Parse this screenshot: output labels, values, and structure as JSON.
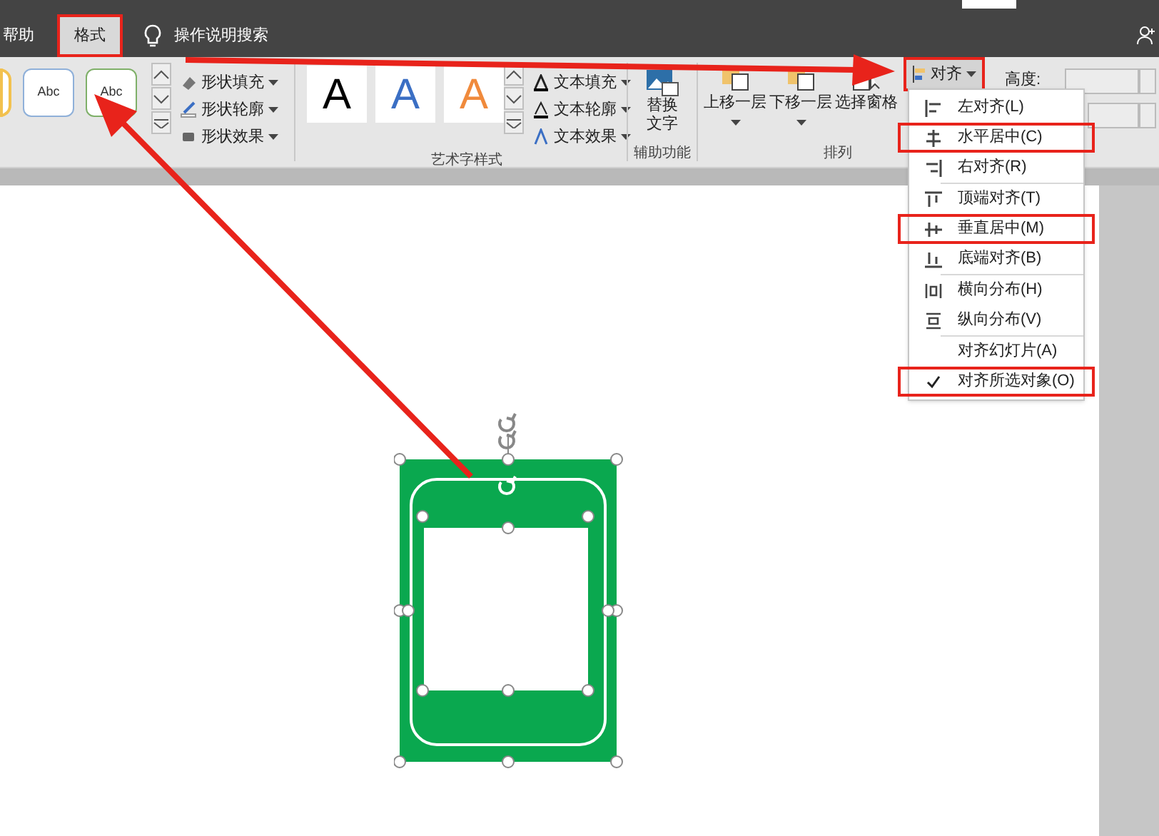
{
  "tabs": [
    {
      "label": "帮助",
      "selected": false,
      "highlighted": false
    },
    {
      "label": "格式",
      "selected": true,
      "highlighted": true
    }
  ],
  "search": {
    "placeholder": "操作说明搜索"
  },
  "shape_styles": [
    "Abc",
    "Abc"
  ],
  "shape_commands": [
    "形状填充",
    "形状轮廓",
    "形状效果"
  ],
  "wordart_styles": [
    {
      "letter": "A",
      "color": "#000000"
    },
    {
      "letter": "A",
      "color": "#3b6fc4"
    },
    {
      "letter": "A",
      "color": "#f08a3c"
    }
  ],
  "text_commands": [
    "文本填充",
    "文本轮廓",
    "文本效果"
  ],
  "groups": {
    "wordart": "艺术字样式",
    "accessibility": "辅助功能",
    "arrange": "排列"
  },
  "alt_text": [
    "替换",
    "文字"
  ],
  "arrange_commands": [
    {
      "label": "上移一层",
      "dropdown": true
    },
    {
      "label": "下移一层",
      "dropdown": true
    },
    {
      "label": "选择窗格",
      "dropdown": false
    }
  ],
  "align_button": {
    "label": "对齐",
    "highlighted": true
  },
  "size_label": "高度:",
  "align_menu": [
    {
      "label": "左对齐(L)",
      "checked": false,
      "highlighted": false,
      "separator_after": false
    },
    {
      "label": "水平居中(C)",
      "checked": false,
      "highlighted": true,
      "separator_after": false
    },
    {
      "label": "右对齐(R)",
      "checked": false,
      "highlighted": false,
      "separator_after": true
    },
    {
      "label": "顶端对齐(T)",
      "checked": false,
      "highlighted": false,
      "separator_after": false
    },
    {
      "label": "垂直居中(M)",
      "checked": false,
      "highlighted": true,
      "separator_after": false
    },
    {
      "label": "底端对齐(B)",
      "checked": false,
      "highlighted": false,
      "separator_after": true
    },
    {
      "label": "横向分布(H)",
      "checked": false,
      "highlighted": false,
      "separator_after": false
    },
    {
      "label": "纵向分布(V)",
      "checked": false,
      "highlighted": false,
      "separator_after": true
    },
    {
      "label": "对齐幻灯片(A)",
      "checked": false,
      "highlighted": false,
      "separator_after": false
    },
    {
      "label": "对齐所选对象(O)",
      "checked": true,
      "highlighted": true,
      "separator_after": false
    }
  ]
}
